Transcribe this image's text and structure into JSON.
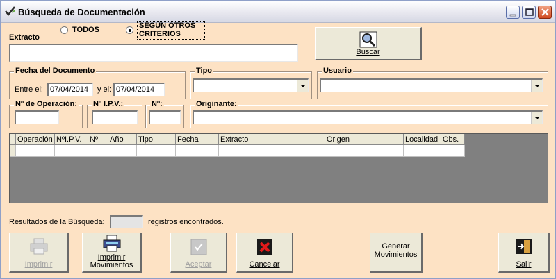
{
  "window": {
    "title": "Búsqueda de Documentación"
  },
  "extracto": {
    "label": "Extracto",
    "value": ""
  },
  "radios": [
    {
      "label": "TODOS",
      "selected": false
    },
    {
      "label_line1": "SEGUN OTROS",
      "label_line2": "CRITERIOS",
      "selected": true
    }
  ],
  "buscar": {
    "label": "Buscar"
  },
  "fecha": {
    "group_title": "Fecha del Documento",
    "from_label": "Entre el:",
    "from_value": "07/04/2014",
    "to_label": "y el:",
    "to_value": "07/04/2014"
  },
  "tipo": {
    "label": "Tipo",
    "value": ""
  },
  "usuario": {
    "label": "Usuario",
    "value": ""
  },
  "nro_operacion": {
    "label": "Nº de Operación:",
    "value": ""
  },
  "nro_ipv": {
    "label": "Nº I.P.V.:",
    "value": ""
  },
  "nro": {
    "label": "Nº:",
    "value": ""
  },
  "originante": {
    "label": "Originante:",
    "value": ""
  },
  "grid": {
    "columns": [
      "Operación",
      "NºI.P.V.",
      "Nº",
      "Año",
      "Tipo",
      "Fecha",
      "Extracto",
      "Origen",
      "Localidad",
      "Obs."
    ],
    "rows": [
      [
        "",
        "",
        "",
        "",
        "",
        "",
        "",
        "",
        "",
        ""
      ]
    ]
  },
  "results": {
    "label": "Resultados de la Búsqueda:",
    "count": "",
    "suffix": "registros encontrados."
  },
  "buttons": {
    "imprimir": "Imprimir",
    "imprimir_mov_line1": "Imprimir",
    "imprimir_mov_line2": "Movimientos",
    "aceptar": "Aceptar",
    "cancelar": "Cancelar",
    "generar_line1": "Generar",
    "generar_line2": "Movimientos",
    "salir": "Salir"
  },
  "colors": {
    "form_bg": "#fde2c4",
    "grid_bg": "#808080",
    "button_bg": "#ece9d8"
  }
}
